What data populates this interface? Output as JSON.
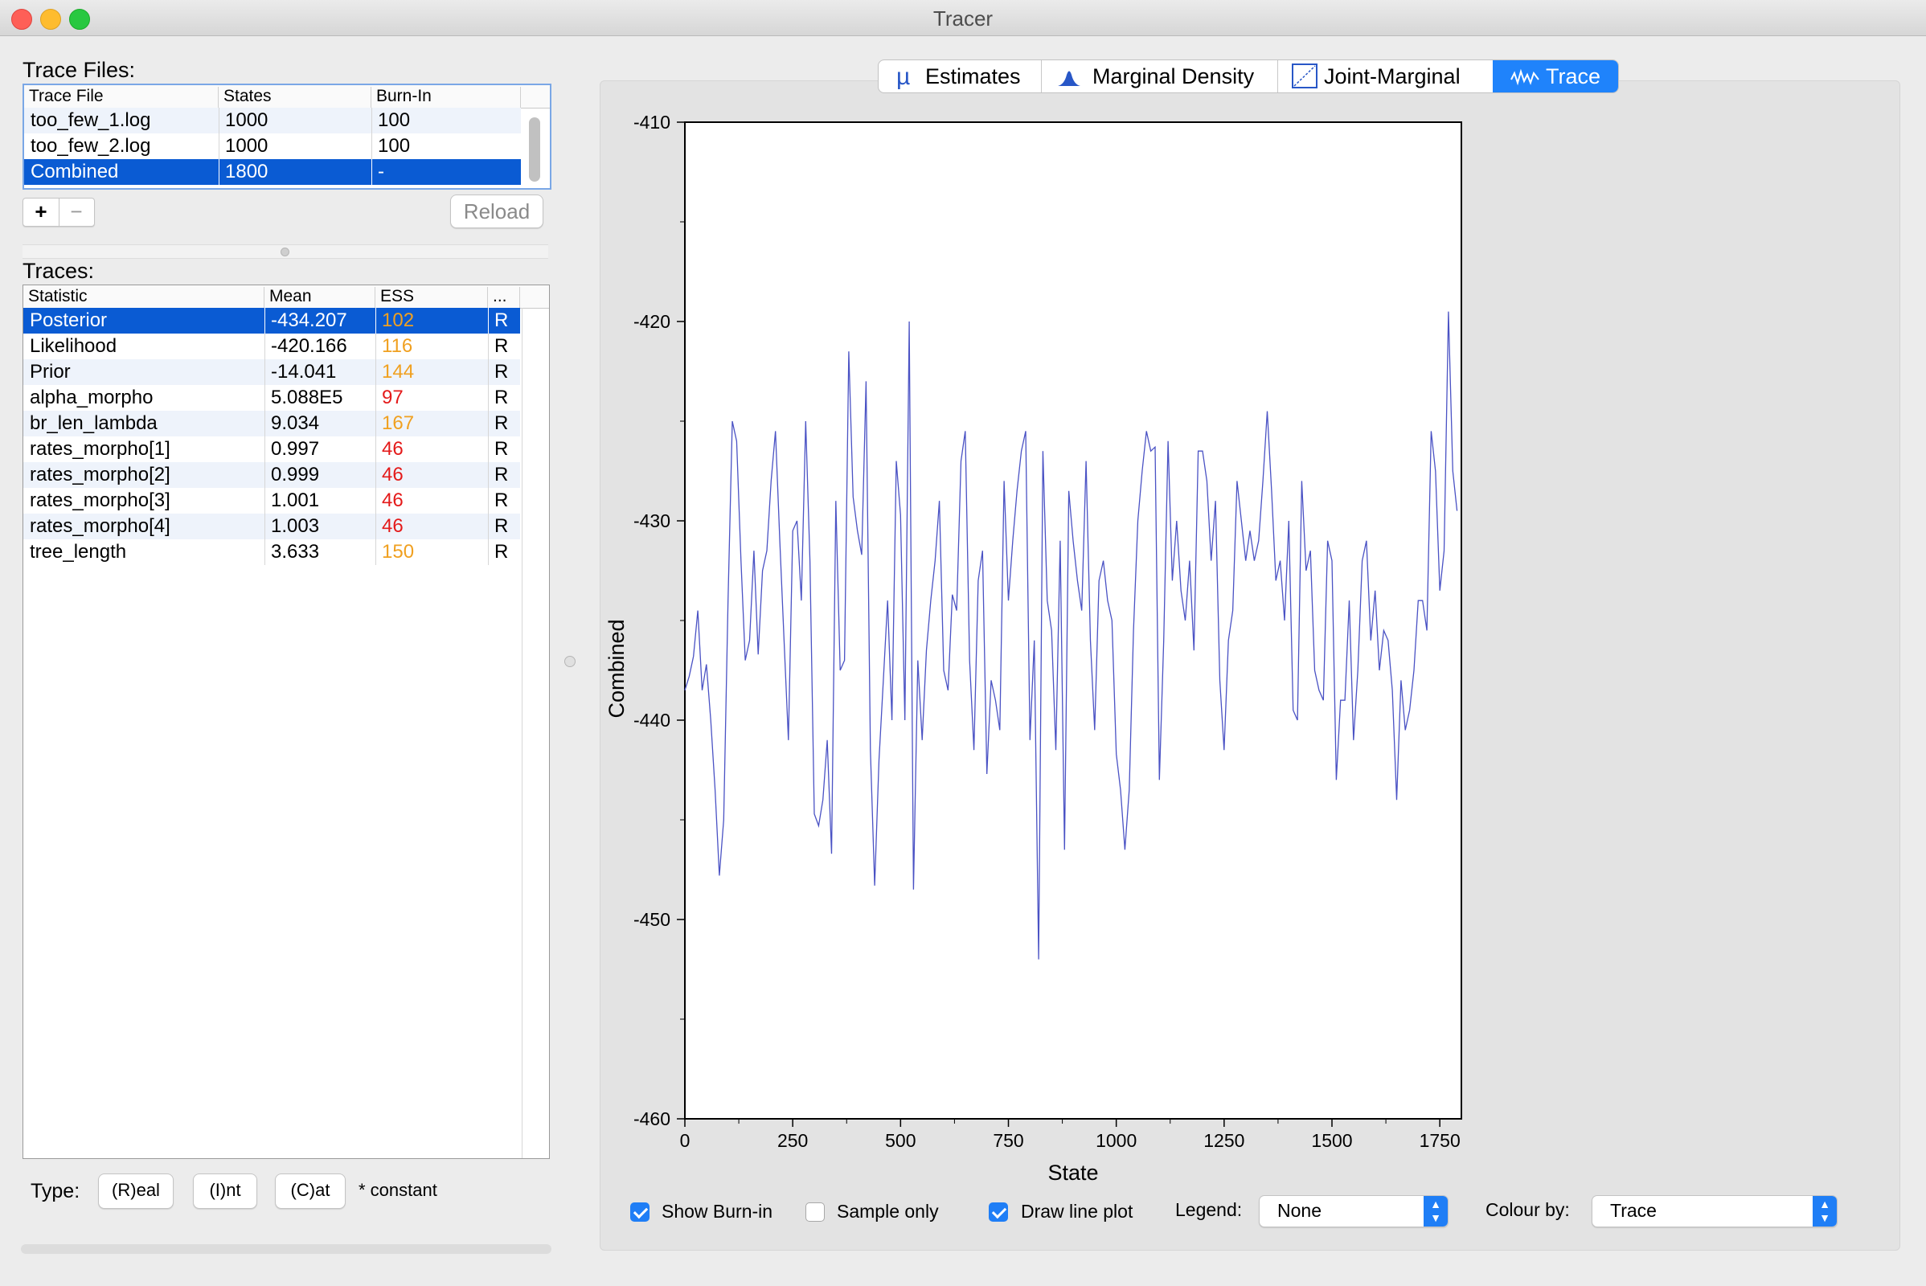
{
  "window": {
    "title": "Tracer"
  },
  "trace_files": {
    "label": "Trace Files:",
    "columns": [
      "Trace File",
      "States",
      "Burn-In"
    ],
    "rows": [
      {
        "file": "too_few_1.log",
        "states": "1000",
        "burnin": "100"
      },
      {
        "file": "too_few_2.log",
        "states": "1000",
        "burnin": "100"
      },
      {
        "file": "Combined",
        "states": "1800",
        "burnin": "-"
      }
    ],
    "selected_index": 2,
    "add_label": "+",
    "remove_label": "−",
    "reload_label": "Reload"
  },
  "traces": {
    "label": "Traces:",
    "columns": [
      "Statistic",
      "Mean",
      "ESS",
      "..."
    ],
    "rows": [
      {
        "stat": "Posterior",
        "mean": "-434.207",
        "ess": "102",
        "type": "R",
        "ess_color": "#f0a020"
      },
      {
        "stat": "Likelihood",
        "mean": "-420.166",
        "ess": "116",
        "type": "R",
        "ess_color": "#f0a020"
      },
      {
        "stat": "Prior",
        "mean": "-14.041",
        "ess": "144",
        "type": "R",
        "ess_color": "#f0a020"
      },
      {
        "stat": "alpha_morpho",
        "mean": "5.088E5",
        "ess": "97",
        "type": "R",
        "ess_color": "#e41a1a"
      },
      {
        "stat": "br_len_lambda",
        "mean": "9.034",
        "ess": "167",
        "type": "R",
        "ess_color": "#f0a020"
      },
      {
        "stat": "rates_morpho[1]",
        "mean": "0.997",
        "ess": "46",
        "type": "R",
        "ess_color": "#e41a1a"
      },
      {
        "stat": "rates_morpho[2]",
        "mean": "0.999",
        "ess": "46",
        "type": "R",
        "ess_color": "#e41a1a"
      },
      {
        "stat": "rates_morpho[3]",
        "mean": "1.001",
        "ess": "46",
        "type": "R",
        "ess_color": "#e41a1a"
      },
      {
        "stat": "rates_morpho[4]",
        "mean": "1.003",
        "ess": "46",
        "type": "R",
        "ess_color": "#e41a1a"
      },
      {
        "stat": "tree_length",
        "mean": "3.633",
        "ess": "150",
        "type": "R",
        "ess_color": "#f0a020"
      }
    ],
    "selected_index": 0
  },
  "type_bar": {
    "label": "Type:",
    "real_label": "(R)eal",
    "int_label": "(I)nt",
    "cat_label": "(C)at",
    "constant_label": "* constant"
  },
  "tabs": [
    {
      "label": "Estimates",
      "icon": "mu-icon",
      "active": false
    },
    {
      "label": "Marginal Density",
      "icon": "density-icon",
      "active": false
    },
    {
      "label": "Joint-Marginal",
      "icon": "joint-marginal-icon",
      "active": false
    },
    {
      "label": "Trace",
      "icon": "trace-icon",
      "active": true
    }
  ],
  "controls": {
    "show_burnin": {
      "label": "Show Burn-in",
      "checked": true
    },
    "sample_only": {
      "label": "Sample only",
      "checked": false
    },
    "draw_line_plot": {
      "label": "Draw line plot",
      "checked": true
    },
    "legend": {
      "label": "Legend:",
      "value": "None"
    },
    "colour_by": {
      "label": "Colour by:",
      "value": "Trace"
    }
  },
  "chart_data": {
    "type": "line",
    "xlabel": "State",
    "ylabel": "Combined",
    "xlim": [
      0,
      1800
    ],
    "ylim": [
      -460,
      -410
    ],
    "xticks": [
      0,
      250,
      500,
      750,
      1000,
      1250,
      1500,
      1750
    ],
    "yticks": [
      -410,
      -420,
      -430,
      -440,
      -450,
      -460
    ],
    "grid": false,
    "line_color": "#4a52c4",
    "series": [
      {
        "values": [
          [
            0,
            -438.5
          ],
          [
            10,
            -437.8
          ],
          [
            20,
            -436.8
          ],
          [
            30,
            -434.5
          ],
          [
            40,
            -438.5
          ],
          [
            50,
            -437.2
          ],
          [
            60,
            -440
          ],
          [
            70,
            -443.5
          ],
          [
            80,
            -447.8
          ],
          [
            90,
            -445
          ],
          [
            100,
            -434
          ],
          [
            110,
            -425
          ],
          [
            120,
            -426
          ],
          [
            130,
            -432
          ],
          [
            140,
            -437
          ],
          [
            150,
            -436
          ],
          [
            160,
            -431.5
          ],
          [
            170,
            -436.7
          ],
          [
            180,
            -432.5
          ],
          [
            190,
            -431.5
          ],
          [
            200,
            -428
          ],
          [
            210,
            -425.5
          ],
          [
            220,
            -431
          ],
          [
            230,
            -436
          ],
          [
            240,
            -441
          ],
          [
            250,
            -430.5
          ],
          [
            260,
            -430
          ],
          [
            270,
            -434
          ],
          [
            280,
            -425
          ],
          [
            290,
            -432
          ],
          [
            300,
            -444.7
          ],
          [
            310,
            -445.3
          ],
          [
            320,
            -444
          ],
          [
            330,
            -441
          ],
          [
            340,
            -446.7
          ],
          [
            350,
            -429
          ],
          [
            360,
            -437.5
          ],
          [
            370,
            -437
          ],
          [
            380,
            -421.5
          ],
          [
            390,
            -428.8
          ],
          [
            400,
            -430.5
          ],
          [
            410,
            -431.7
          ],
          [
            420,
            -423
          ],
          [
            430,
            -441.5
          ],
          [
            440,
            -448.3
          ],
          [
            450,
            -442
          ],
          [
            460,
            -438
          ],
          [
            470,
            -434
          ],
          [
            480,
            -440
          ],
          [
            490,
            -427
          ],
          [
            500,
            -429.7
          ],
          [
            510,
            -440
          ],
          [
            520,
            -420
          ],
          [
            530,
            -448.5
          ],
          [
            540,
            -437
          ],
          [
            550,
            -441
          ],
          [
            560,
            -436.5
          ],
          [
            570,
            -434
          ],
          [
            580,
            -432
          ],
          [
            590,
            -429
          ],
          [
            600,
            -437.5
          ],
          [
            610,
            -438.5
          ],
          [
            620,
            -433.7
          ],
          [
            630,
            -434.5
          ],
          [
            640,
            -427
          ],
          [
            650,
            -425.5
          ],
          [
            660,
            -437
          ],
          [
            670,
            -441.5
          ],
          [
            680,
            -433
          ],
          [
            690,
            -431.5
          ],
          [
            700,
            -442.7
          ],
          [
            710,
            -438
          ],
          [
            720,
            -439
          ],
          [
            730,
            -440.5
          ],
          [
            740,
            -428
          ],
          [
            750,
            -434
          ],
          [
            760,
            -431
          ],
          [
            770,
            -428.5
          ],
          [
            780,
            -426.5
          ],
          [
            790,
            -425.5
          ],
          [
            800,
            -441
          ],
          [
            810,
            -436
          ],
          [
            820,
            -452
          ],
          [
            830,
            -426.5
          ],
          [
            840,
            -434
          ],
          [
            850,
            -435.5
          ],
          [
            860,
            -441.5
          ],
          [
            870,
            -431
          ],
          [
            880,
            -446.5
          ],
          [
            890,
            -428.5
          ],
          [
            900,
            -431
          ],
          [
            910,
            -433
          ],
          [
            920,
            -434.5
          ],
          [
            930,
            -427
          ],
          [
            940,
            -436
          ],
          [
            950,
            -440.5
          ],
          [
            960,
            -433
          ],
          [
            970,
            -432
          ],
          [
            980,
            -434
          ],
          [
            990,
            -435
          ],
          [
            1000,
            -441.7
          ],
          [
            1010,
            -443.5
          ],
          [
            1020,
            -446.5
          ],
          [
            1030,
            -443.5
          ],
          [
            1040,
            -435.5
          ],
          [
            1050,
            -430
          ],
          [
            1060,
            -427.5
          ],
          [
            1070,
            -425.5
          ],
          [
            1080,
            -426.5
          ],
          [
            1090,
            -426.3
          ],
          [
            1100,
            -443
          ],
          [
            1110,
            -436
          ],
          [
            1120,
            -426
          ],
          [
            1130,
            -433
          ],
          [
            1140,
            -430
          ],
          [
            1150,
            -433.5
          ],
          [
            1160,
            -435
          ],
          [
            1170,
            -432
          ],
          [
            1180,
            -436.5
          ],
          [
            1190,
            -426.5
          ],
          [
            1200,
            -426.5
          ],
          [
            1210,
            -428
          ],
          [
            1220,
            -432
          ],
          [
            1230,
            -429
          ],
          [
            1240,
            -438
          ],
          [
            1250,
            -441.5
          ],
          [
            1260,
            -436
          ],
          [
            1270,
            -434.5
          ],
          [
            1280,
            -428
          ],
          [
            1290,
            -430
          ],
          [
            1300,
            -432
          ],
          [
            1310,
            -430.5
          ],
          [
            1320,
            -432
          ],
          [
            1330,
            -431
          ],
          [
            1340,
            -428
          ],
          [
            1350,
            -424.5
          ],
          [
            1360,
            -428.5
          ],
          [
            1370,
            -433
          ],
          [
            1380,
            -432
          ],
          [
            1390,
            -435
          ],
          [
            1400,
            -430
          ],
          [
            1410,
            -439.5
          ],
          [
            1420,
            -440
          ],
          [
            1430,
            -428
          ],
          [
            1440,
            -432.5
          ],
          [
            1450,
            -431.5
          ],
          [
            1460,
            -437.5
          ],
          [
            1470,
            -438.5
          ],
          [
            1480,
            -439
          ],
          [
            1490,
            -431
          ],
          [
            1500,
            -432
          ],
          [
            1510,
            -443
          ],
          [
            1520,
            -439
          ],
          [
            1530,
            -439
          ],
          [
            1540,
            -434
          ],
          [
            1550,
            -441
          ],
          [
            1560,
            -437.5
          ],
          [
            1570,
            -432
          ],
          [
            1580,
            -431
          ],
          [
            1590,
            -436
          ],
          [
            1600,
            -433.5
          ],
          [
            1610,
            -437.5
          ],
          [
            1620,
            -435.5
          ],
          [
            1630,
            -436
          ],
          [
            1640,
            -438.5
          ],
          [
            1650,
            -444
          ],
          [
            1660,
            -438
          ],
          [
            1670,
            -440.5
          ],
          [
            1680,
            -439.5
          ],
          [
            1690,
            -437.5
          ],
          [
            1700,
            -434
          ],
          [
            1710,
            -434
          ],
          [
            1720,
            -435.5
          ],
          [
            1730,
            -425.5
          ],
          [
            1740,
            -427.5
          ],
          [
            1750,
            -433.5
          ],
          [
            1760,
            -431.5
          ],
          [
            1770,
            -419.5
          ],
          [
            1780,
            -427.5
          ],
          [
            1790,
            -429.5
          ]
        ]
      }
    ]
  }
}
